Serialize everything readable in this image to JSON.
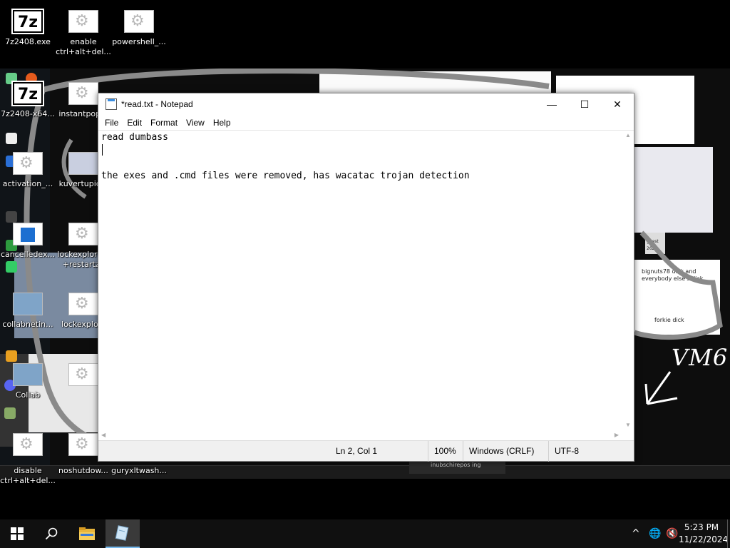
{
  "desktop": {
    "top_icons": [
      {
        "label": "7z2408.exe",
        "icon": "7z-icon"
      },
      {
        "label": "enable ctrl+alt+del...",
        "icon": "gear-icon"
      },
      {
        "label": "powershell_...",
        "icon": "gear-icon"
      }
    ],
    "left_icons": [
      {
        "label": "7z2408-x64...",
        "icon": "7z-icon"
      },
      {
        "label": "instantpop...",
        "icon": "gear-icon"
      },
      {
        "label": "activation_...",
        "icon": "gear-icon"
      },
      {
        "label": "kuvertupic...",
        "icon": "picture-icon"
      },
      {
        "label": "cancelledex...",
        "icon": "document-icon"
      },
      {
        "label": "lockexplore...",
        "icon": "gear-icon"
      },
      {
        "label": "collabnetin...",
        "icon": "computer-icon"
      },
      {
        "label": "lockexplo...",
        "icon": "gear-icon"
      },
      {
        "label": "Collab",
        "icon": "computer-icon"
      },
      {
        "label": "disable ctrl+alt+del...",
        "icon": "gear-icon"
      },
      {
        "label": "noshutdow...",
        "icon": "gear-icon"
      },
      {
        "label": "guryxltwash...",
        "icon": "gear-icon"
      }
    ],
    "lockexplore_second_line": "+restartzo",
    "background_text": {
      "vm6": "VM6",
      "note_1": "bignuts78 dick and everybody else's dick",
      "note_2": "forkie dick",
      "note_3": "guest 2620",
      "inner_notification": "inubschirepos ing"
    }
  },
  "notepad": {
    "title": "*read.txt - Notepad",
    "menu": [
      "File",
      "Edit",
      "Format",
      "View",
      "Help"
    ],
    "content": "read dumbass\n\n\nthe exes and .cmd files were removed, has wacatac trojan detection",
    "status": {
      "position": "Ln 2, Col 1",
      "zoom": "100%",
      "line_ending": "Windows (CRLF)",
      "encoding": "UTF-8"
    },
    "window_buttons": {
      "minimize": "—",
      "maximize": "☐",
      "close": "✕"
    }
  },
  "taskbar": {
    "items": [
      "start-button",
      "search-button",
      "file-explorer",
      "notepad"
    ],
    "clock_time": "5:23 PM",
    "clock_date": "11/22/2024",
    "tray_icons": [
      "chevron-up-icon",
      "network-globe-icon",
      "volume-muted-icon"
    ]
  }
}
